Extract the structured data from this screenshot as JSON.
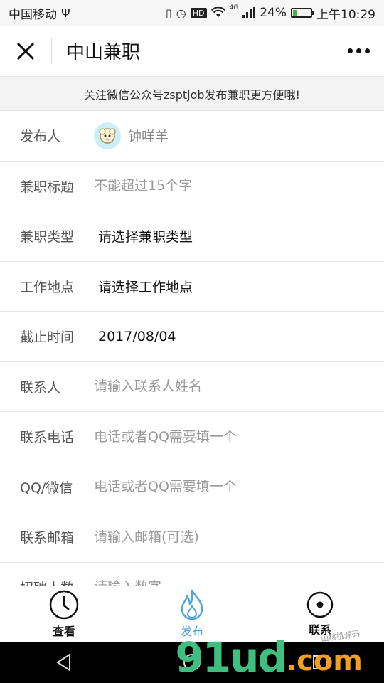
{
  "status_bar": {
    "carrier": "中国移动",
    "usb_icon": "usb-icon",
    "hd_badge": "HD",
    "network": "4G",
    "battery": "24%",
    "battery_level": 0.24,
    "time": "上午10:29"
  },
  "header": {
    "title": "中山兼职",
    "close_icon": "close-icon",
    "more_icon": "more-dots-icon"
  },
  "notice": "关注微信公众号zsptjob发布兼职更方便哦!",
  "form": {
    "publisher": {
      "label": "发布人",
      "name": "钟咩羊"
    },
    "title": {
      "label": "兼职标题",
      "placeholder": "不能超过15个字"
    },
    "type": {
      "label": "兼职类型",
      "value": "请选择兼职类型"
    },
    "location": {
      "label": "工作地点",
      "value": "请选择工作地点"
    },
    "deadline": {
      "label": "截止时间",
      "value": "2017/08/04"
    },
    "contact": {
      "label": "联系人",
      "placeholder": "请输入联系人姓名"
    },
    "phone": {
      "label": "联系电话",
      "placeholder": "电话或者QQ需要填一个"
    },
    "qq": {
      "label": "QQ/微信",
      "placeholder": "电话或者QQ需要填一个"
    },
    "email": {
      "label": "联系邮箱",
      "placeholder": "请输入邮箱(可选)"
    },
    "headcount": {
      "label": "招聘人数",
      "placeholder": "请输入数字"
    }
  },
  "tabs": [
    {
      "label": "查看",
      "icon": "clock-icon"
    },
    {
      "label": "发布",
      "icon": "flame-icon",
      "active": true
    },
    {
      "label": "联系",
      "icon": "target-icon"
    }
  ],
  "watermark": {
    "brand": "91ud",
    "suffix": ".com",
    "small": "山核桃源码"
  },
  "colors": {
    "accent": "#4ea6dc",
    "watermark_green": "#3fbf7f",
    "watermark_orange": "#f0a020"
  }
}
